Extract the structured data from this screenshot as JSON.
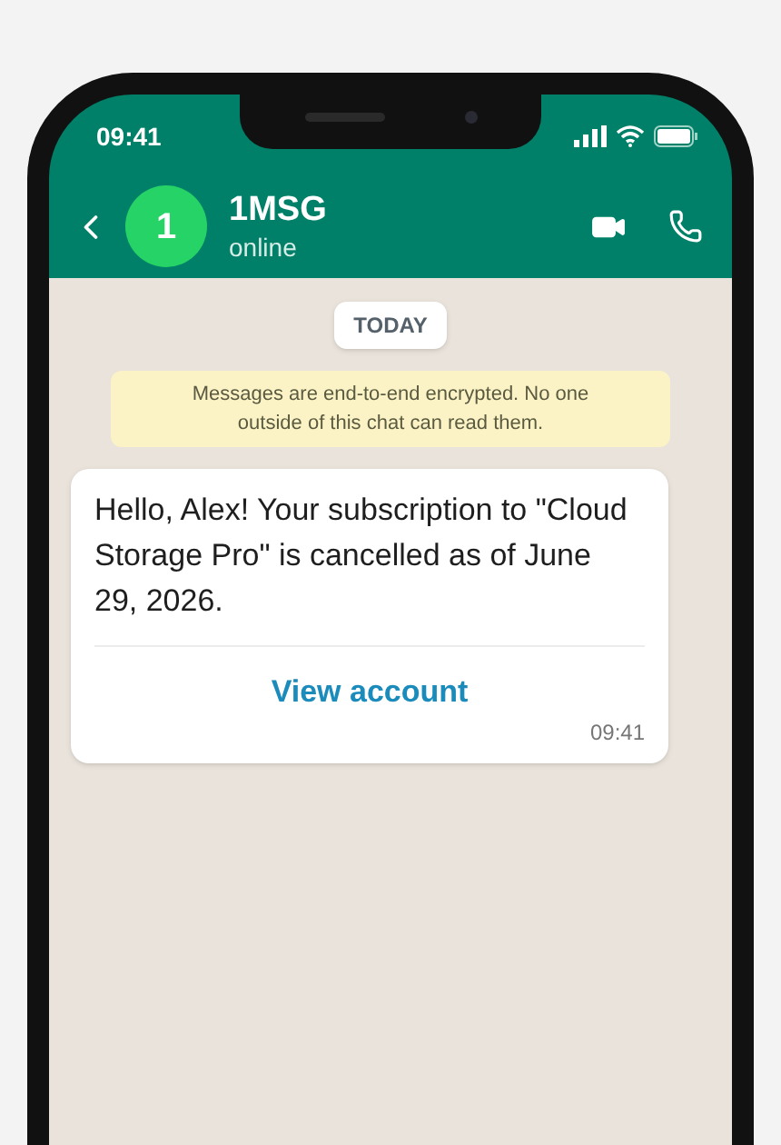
{
  "status_bar": {
    "time": "09:41"
  },
  "header": {
    "avatar_initial": "1",
    "name": "1MSG",
    "status": "online"
  },
  "chat": {
    "date_chip": "TODAY",
    "encryption_notice": "Messages are end-to-end encrypted. No one outside of this chat can read them.",
    "message": {
      "text": "Hello, Alex! Your subscription to \"Cloud Storage Pro\" is cancelled as of June 29, 2026.",
      "button": "View account",
      "time": "09:41"
    }
  }
}
